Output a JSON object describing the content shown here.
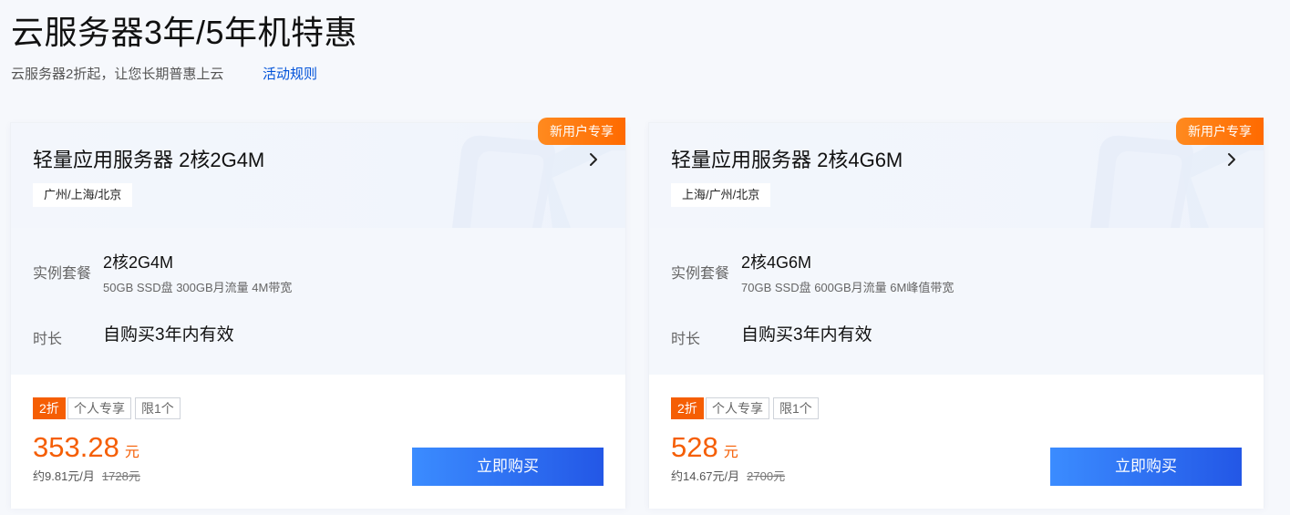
{
  "header": {
    "title": "云服务器3年/5年机特惠",
    "subtitle": "云服务器2折起，让您长期普惠上云",
    "rules_link": "活动规则"
  },
  "colors": {
    "accent_orange": "#f55e04",
    "button_blue": "#2357e6",
    "link_blue": "#0052d9"
  },
  "labels": {
    "spec": "实例套餐",
    "duration": "时长",
    "buy": "立即购买"
  },
  "cards": [
    {
      "badge": "新用户专享",
      "name": "轻量应用服务器 2核2G4M",
      "region": "广州/上海/北京",
      "spec_main": "2核2G4M",
      "spec_sub": "50GB SSD盘 300GB月流量 4M带宽",
      "duration": "自购买3年内有效",
      "tags": [
        "2折",
        "个人专享",
        "限1个"
      ],
      "price": "353.28",
      "price_unit": "元",
      "per_month": "约9.81元/月",
      "original_price": "1728元"
    },
    {
      "badge": "新用户专享",
      "name": "轻量应用服务器 2核4G6M",
      "region": "上海/广州/北京",
      "spec_main": "2核4G6M",
      "spec_sub": "70GB SSD盘 600GB月流量 6M峰值带宽",
      "duration": "自购买3年内有效",
      "tags": [
        "2折",
        "个人专享",
        "限1个"
      ],
      "price": "528",
      "price_unit": "元",
      "per_month": "约14.67元/月",
      "original_price": "2700元"
    }
  ]
}
